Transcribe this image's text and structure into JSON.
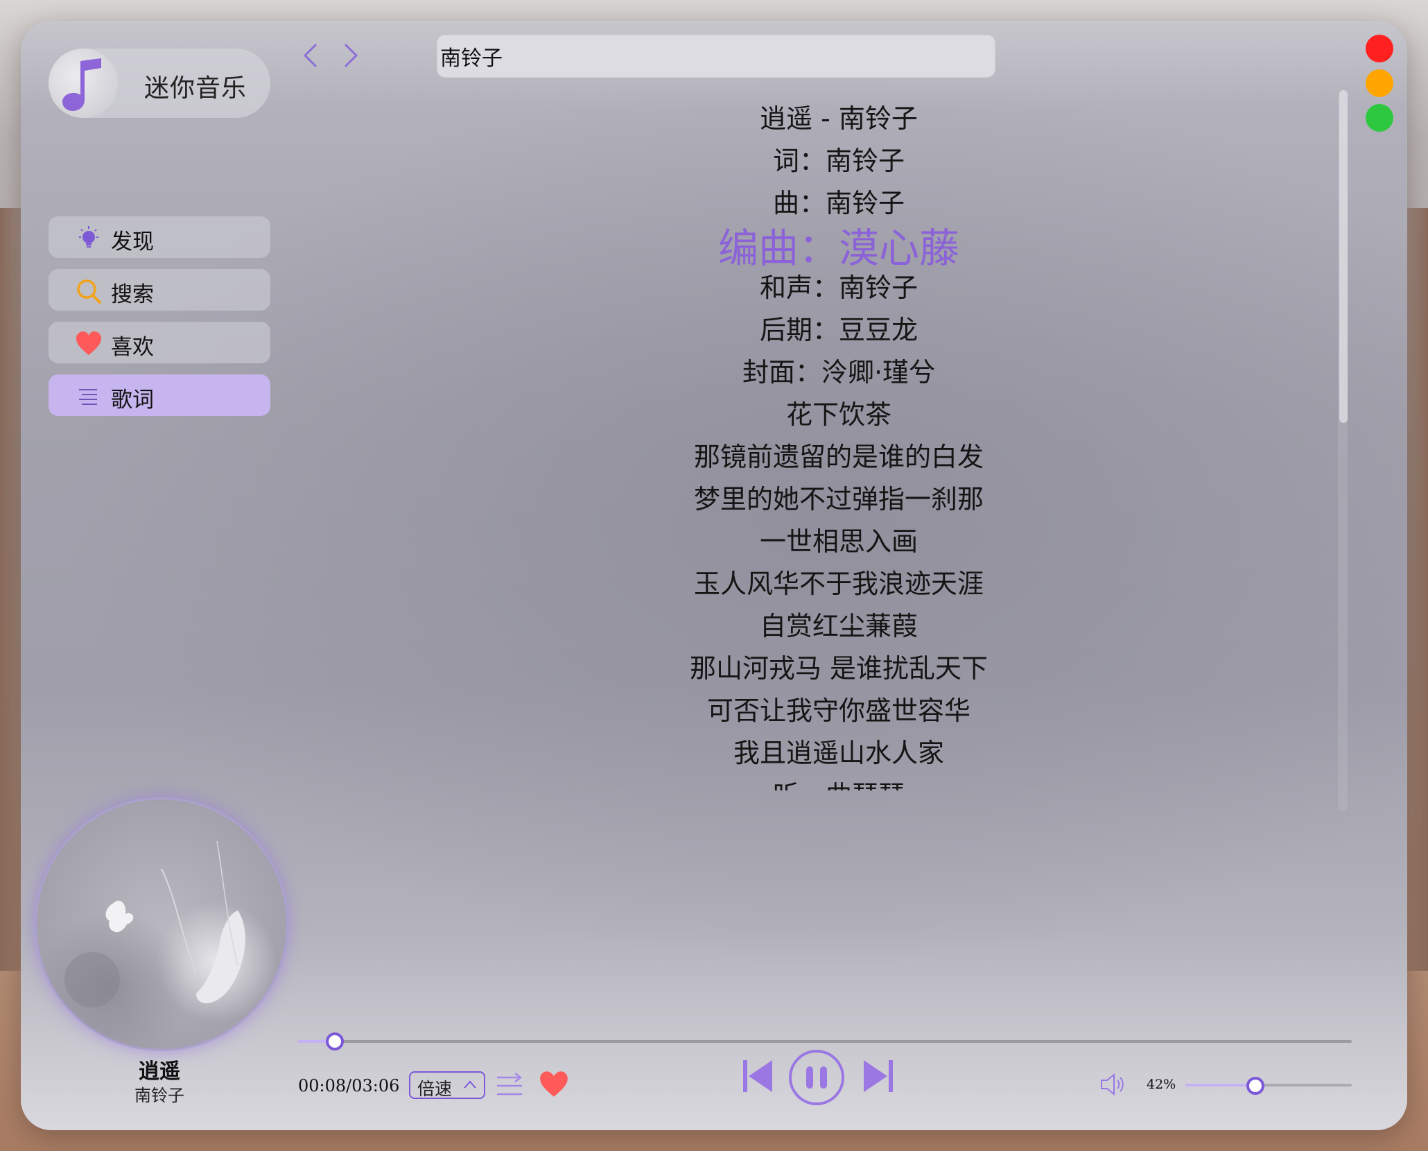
{
  "app": {
    "name": "迷你音乐"
  },
  "colors": {
    "accent": "#8b62d8",
    "active_nav": "#c7b5f0",
    "close": "#ff2020",
    "minimize": "#ffa500",
    "maximize": "#2ec840"
  },
  "sidebar": {
    "items": [
      {
        "label": "发现",
        "icon": "lightbulb-icon",
        "active": false
      },
      {
        "label": "搜索",
        "icon": "search-icon",
        "active": false
      },
      {
        "label": "喜欢",
        "icon": "heart-icon",
        "active": false
      },
      {
        "label": "歌词",
        "icon": "lyrics-list-icon",
        "active": true
      }
    ]
  },
  "search": {
    "value": "南铃子"
  },
  "lyrics": {
    "current_index": 3,
    "lines": [
      "逍遥 - 南铃子",
      "词：南铃子",
      "曲：南铃子",
      "编曲：漠心藤",
      "和声：南铃子",
      "后期：豆豆龙",
      "封面：泠卿·瑾兮",
      "花下饮茶",
      "那镜前遗留的是谁的白发",
      "梦里的她不过弹指一刹那",
      "一世相思入画",
      "玉人风华不于我浪迹天涯",
      "自赏红尘蒹葭",
      "那山河戎马 是谁扰乱天下",
      "可否让我守你盛世容华",
      "我且逍遥山水人家",
      "听一曲琵琶"
    ]
  },
  "now_playing": {
    "title": "逍遥",
    "artist": "南铃子",
    "time": "00:08/03:06",
    "progress": 0.035
  },
  "controls": {
    "speed_label": "倍速",
    "volume_label": "42%",
    "volume": 0.42
  }
}
